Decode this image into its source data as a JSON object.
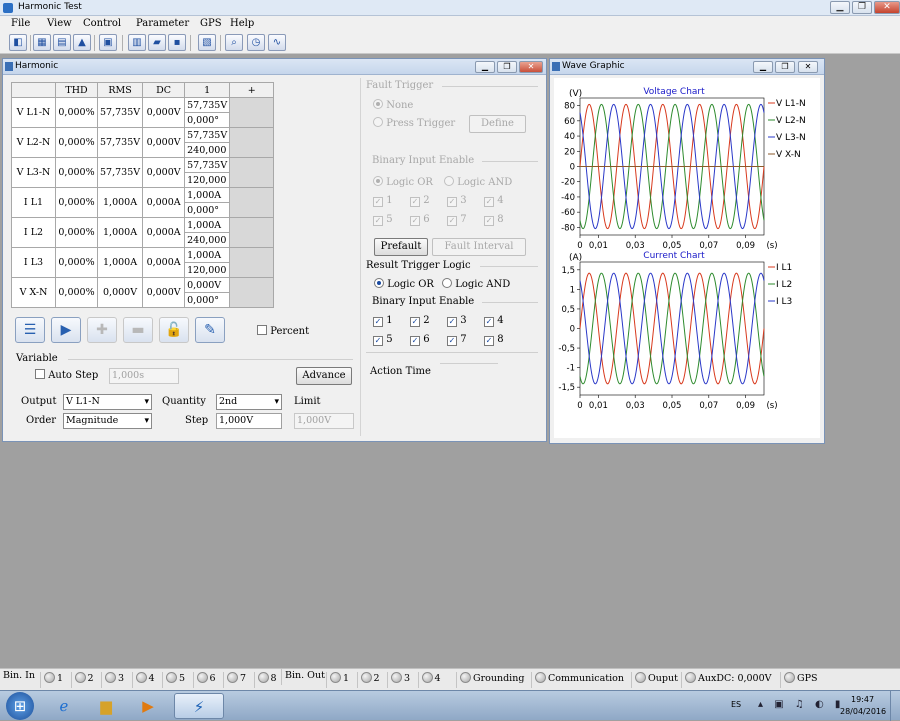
{
  "app": {
    "title": "Harmonic Test"
  },
  "menu": [
    "File",
    "View",
    "Control",
    "Parameter",
    "GPS",
    "Help"
  ],
  "harmonic_window": {
    "title": "Harmonic",
    "headers": [
      "",
      "THD",
      "RMS",
      "DC",
      "1",
      "+"
    ],
    "rows": [
      {
        "label": "V L1-N",
        "thd": "0,000%",
        "rms": "57,735V",
        "dc": "0,000V",
        "mag": "57,735V",
        "phase": "0,000°"
      },
      {
        "label": "V L2-N",
        "thd": "0,000%",
        "rms": "57,735V",
        "dc": "0,000V",
        "mag": "57,735V",
        "phase": "240,000"
      },
      {
        "label": "V L3-N",
        "thd": "0,000%",
        "rms": "57,735V",
        "dc": "0,000V",
        "mag": "57,735V",
        "phase": "120,000"
      },
      {
        "label": "I L1",
        "thd": "0,000%",
        "rms": "1,000A",
        "dc": "0,000A",
        "mag": "1,000A",
        "phase": "0,000°"
      },
      {
        "label": "I L2",
        "thd": "0,000%",
        "rms": "1,000A",
        "dc": "0,000A",
        "mag": "1,000A",
        "phase": "240,000"
      },
      {
        "label": "I L3",
        "thd": "0,000%",
        "rms": "1,000A",
        "dc": "0,000A",
        "mag": "1,000A",
        "phase": "120,000"
      },
      {
        "label": "V X-N",
        "thd": "0,000%",
        "rms": "0,000V",
        "dc": "0,000V",
        "mag": "0,000V",
        "phase": "0,000°"
      }
    ],
    "percent_label": "Percent",
    "variable": {
      "section_label": "Variable",
      "auto_step_label": "Auto Step",
      "auto_step_value": "1,000s",
      "advance_label": "Advance",
      "output_label": "Output",
      "output_value": "V L1-N",
      "quantity_label": "Quantity",
      "quantity_value": "2nd",
      "limit_label": "Limit",
      "limit_value": "1,000V",
      "order_label": "Order",
      "order_value": "Magnitude",
      "step_label": "Step",
      "step_value": "1,000V"
    },
    "fault_trigger": {
      "title": "Fault Trigger",
      "none_label": "None",
      "press_trigger_label": "Press Trigger",
      "define_label": "Define",
      "binary_input_enable_label": "Binary Input Enable",
      "logic_or_label": "Logic OR",
      "logic_and_label": "Logic AND",
      "inputs": [
        "1",
        "2",
        "3",
        "4",
        "5",
        "6",
        "7",
        "8"
      ]
    },
    "prefault_label": "Prefault",
    "fault_interval_label": "Fault Interval",
    "result_trigger": {
      "title": "Result Trigger Logic",
      "logic_or_label": "Logic OR",
      "logic_and_label": "Logic AND",
      "binary_input_enable_label": "Binary Input Enable",
      "inputs": [
        "1",
        "2",
        "3",
        "4",
        "5",
        "6",
        "7",
        "8"
      ]
    },
    "action_time_label": "Action Time"
  },
  "wave_window": {
    "title": "Wave Graphic"
  },
  "chart_data": [
    {
      "type": "line",
      "title": "Voltage Chart",
      "ylabel": "(V)",
      "xlabel": "(s)",
      "ylim": [
        -90,
        90
      ],
      "xlim": [
        0,
        0.1
      ],
      "yticks": [
        "80",
        "60",
        "40",
        "20",
        "0",
        "-20",
        "-40",
        "-60",
        "-80"
      ],
      "xticks": [
        "0",
        "0,01",
        "0,03",
        "0,05",
        "0,07",
        "0,09"
      ],
      "frequency_hz": 50,
      "series": [
        {
          "name": "V L1-N",
          "amplitude": 81.65,
          "phase_deg": 0,
          "color": "#d83a1e"
        },
        {
          "name": "V L2-N",
          "amplitude": 81.65,
          "phase_deg": 240,
          "color": "#2e8b2e"
        },
        {
          "name": "V L3-N",
          "amplitude": 81.65,
          "phase_deg": 120,
          "color": "#2a38c8"
        },
        {
          "name": "V X-N",
          "amplitude": 0,
          "phase_deg": 0,
          "color": "#8b5a2b"
        }
      ]
    },
    {
      "type": "line",
      "title": "Current Chart",
      "ylabel": "(A)",
      "xlabel": "(s)",
      "ylim": [
        -1.7,
        1.7
      ],
      "xlim": [
        0,
        0.1
      ],
      "yticks": [
        "1,5",
        "1",
        "0,5",
        "0",
        "-0,5",
        "-1",
        "-1,5"
      ],
      "xticks": [
        "0",
        "0,01",
        "0,03",
        "0,05",
        "0,07",
        "0,09"
      ],
      "frequency_hz": 50,
      "series": [
        {
          "name": "I L1",
          "amplitude": 1.414,
          "phase_deg": 0,
          "color": "#d83a1e"
        },
        {
          "name": "I L2",
          "amplitude": 1.414,
          "phase_deg": 240,
          "color": "#2e8b2e"
        },
        {
          "name": "I L3",
          "amplitude": 1.414,
          "phase_deg": 120,
          "color": "#2a38c8"
        }
      ]
    }
  ],
  "statusbar": {
    "bin_in_label": "Bin. In",
    "bin_in": [
      "1",
      "2",
      "3",
      "4",
      "5",
      "6",
      "7",
      "8"
    ],
    "bin_out_label": "Bin. Out",
    "bin_out": [
      "1",
      "2",
      "3",
      "4"
    ],
    "grounding": "Grounding",
    "communication": "Communication",
    "output": "Ouput",
    "auxdc": "AuxDC: 0,000V",
    "gps": "GPS"
  },
  "taskbar": {
    "lang": "ES",
    "time": "19:47",
    "date": "28/04/2016"
  }
}
